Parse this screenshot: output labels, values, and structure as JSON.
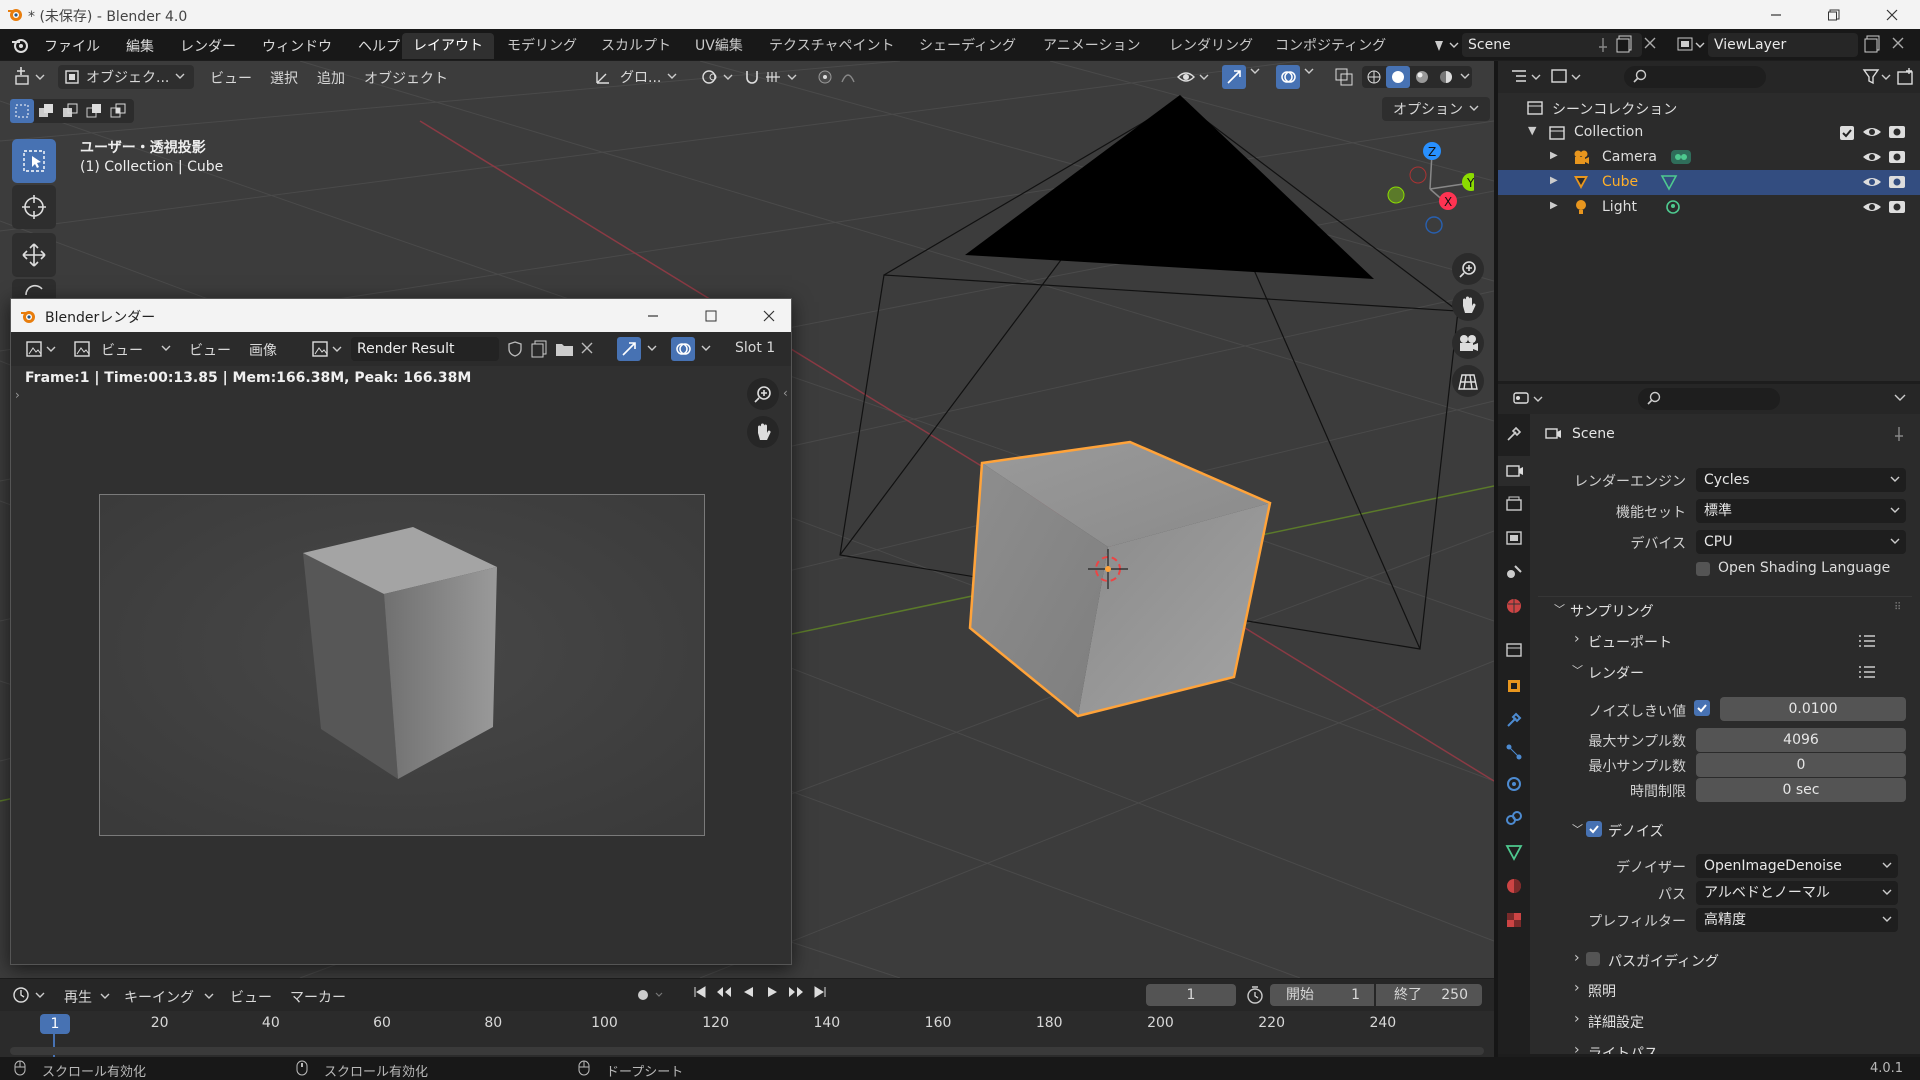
{
  "window": {
    "title": "* (未保存) - Blender 4.0"
  },
  "menu": {
    "file": "ファイル",
    "edit": "編集",
    "render": "レンダー",
    "window": "ウィンドウ",
    "help": "ヘルプ"
  },
  "workspaces": [
    "レイアウト",
    "モデリング",
    "スカルプト",
    "UV編集",
    "テクスチャペイント",
    "シェーディング",
    "アニメーション",
    "レンダリング",
    "コンポジティング"
  ],
  "scene_field": "Scene",
  "viewlayer_field": "ViewLayer",
  "viewport": {
    "mode": "オブジェク...",
    "menus": {
      "view": "ビュー",
      "select": "選択",
      "add": "追加",
      "object": "オブジェクト"
    },
    "transform": "グロ...",
    "options": "オプション",
    "view_name": "ユーザー・透視投影",
    "collection_info": "(1) Collection | Cube"
  },
  "render_window": {
    "title": "Blenderレンダー",
    "view_menu": "ビュー",
    "view_menu2": "ビュー",
    "image_menu": "画像",
    "image_name": "Render Result",
    "slot": "Slot 1",
    "info": "Frame:1 | Time:00:13.85 | Mem:166.38M, Peak: 166.38M"
  },
  "outliner": {
    "scene_collection": "シーンコレクション",
    "collection": "Collection",
    "items": [
      {
        "name": "Camera",
        "selected": false
      },
      {
        "name": "Cube",
        "selected": true
      },
      {
        "name": "Light",
        "selected": false
      }
    ]
  },
  "properties": {
    "scene": "Scene",
    "render_engine": {
      "label": "レンダーエンジン",
      "value": "Cycles"
    },
    "feature_set": {
      "label": "機能セット",
      "value": "標準"
    },
    "device": {
      "label": "デバイス",
      "value": "CPU"
    },
    "osl": "Open Shading Language",
    "sampling": "サンプリング",
    "viewport_sub": "ビューポート",
    "render_sub": "レンダー",
    "noise_threshold": {
      "label": "ノイズしきい値",
      "value": "0.0100"
    },
    "max_samples": {
      "label": "最大サンプル数",
      "value": "4096"
    },
    "min_samples": {
      "label": "最小サンプル数",
      "value": "0"
    },
    "time_limit": {
      "label": "時間制限",
      "value": "0 sec"
    },
    "denoise": "デノイズ",
    "denoiser": {
      "label": "デノイザー",
      "value": "OpenImageDenoise"
    },
    "passes": {
      "label": "パス",
      "value": "アルベドとノーマル"
    },
    "prefilter": {
      "label": "プレフィルター",
      "value": "高精度"
    },
    "path_guiding": "パスガイディング",
    "lights": "照明",
    "advanced": "詳細設定",
    "light_paths": "ライトパス"
  },
  "timeline": {
    "playback": "再生",
    "keying": "キーイング",
    "view": "ビュー",
    "marker": "マーカー",
    "current_frame": "1",
    "start_label": "開始",
    "start_value": "1",
    "end_label": "終了",
    "end_value": "250",
    "ruler": [
      "1",
      "20",
      "40",
      "60",
      "80",
      "100",
      "120",
      "140",
      "160",
      "180",
      "200",
      "220",
      "240"
    ]
  },
  "statusbar": {
    "s1": "スクロール有効化",
    "s2": "スクロール有効化",
    "s3": "ドープシート",
    "version": "4.0.1"
  },
  "colors": {
    "accent": "#4772b3",
    "selection": "#ffa33a",
    "x_axis": "#ff3352",
    "y_axis": "#8bdc00",
    "z_axis": "#2890ff"
  }
}
